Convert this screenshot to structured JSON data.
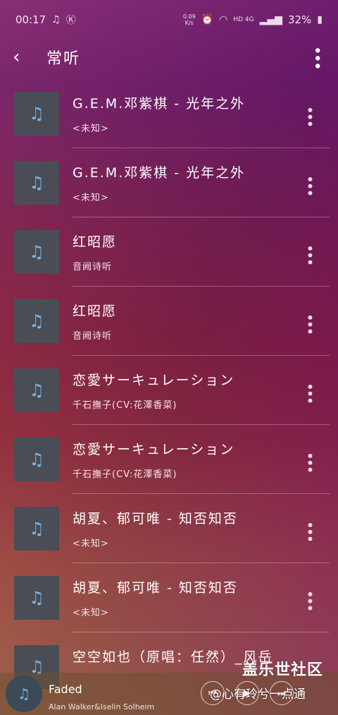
{
  "status_bar": {
    "time": "00:17",
    "netspeed_value": "0.09",
    "netspeed_unit": "K/s",
    "network": "HD 4G",
    "battery": "32%",
    "icons": [
      "music-note-icon",
      "k-app-icon",
      "alarm-icon",
      "wifi-icon",
      "signal-icon",
      "battery-icon"
    ]
  },
  "header": {
    "title": "常听",
    "back_icon": "chevron-left-icon",
    "more_icon": "more-vertical-icon"
  },
  "songs": [
    {
      "title": "G.E.M.邓紫棋 - 光年之外",
      "artist": "<未知>"
    },
    {
      "title": "G.E.M.邓紫棋 - 光年之外",
      "artist": "<未知>"
    },
    {
      "title": "红昭愿",
      "artist": "音阙诗听"
    },
    {
      "title": "红昭愿",
      "artist": "音阙诗听"
    },
    {
      "title": "恋愛サーキュレーション",
      "artist": "千石撫子(CV:花澤香菜)"
    },
    {
      "title": "恋愛サーキュレーション",
      "artist": "千石撫子(CV:花澤香菜)"
    },
    {
      "title": "胡夏、郁可唯 - 知否知否",
      "artist": "<未知>"
    },
    {
      "title": "胡夏、郁可唯 - 知否知否",
      "artist": "<未知>"
    },
    {
      "title": "空空如也（原唱：任然）_风岳",
      "artist": ""
    }
  ],
  "mini_player": {
    "title": "Faded",
    "artist": "Alan Walker&Iselin Solheim",
    "controls": [
      "previous-icon",
      "play-icon",
      "next-icon"
    ]
  },
  "watermark": {
    "title": "盖乐世社区",
    "subtitle": "@心有玲兮一点通"
  },
  "colors": {
    "cover_bg": "#4a4d55",
    "note": "#7ab6ea"
  }
}
